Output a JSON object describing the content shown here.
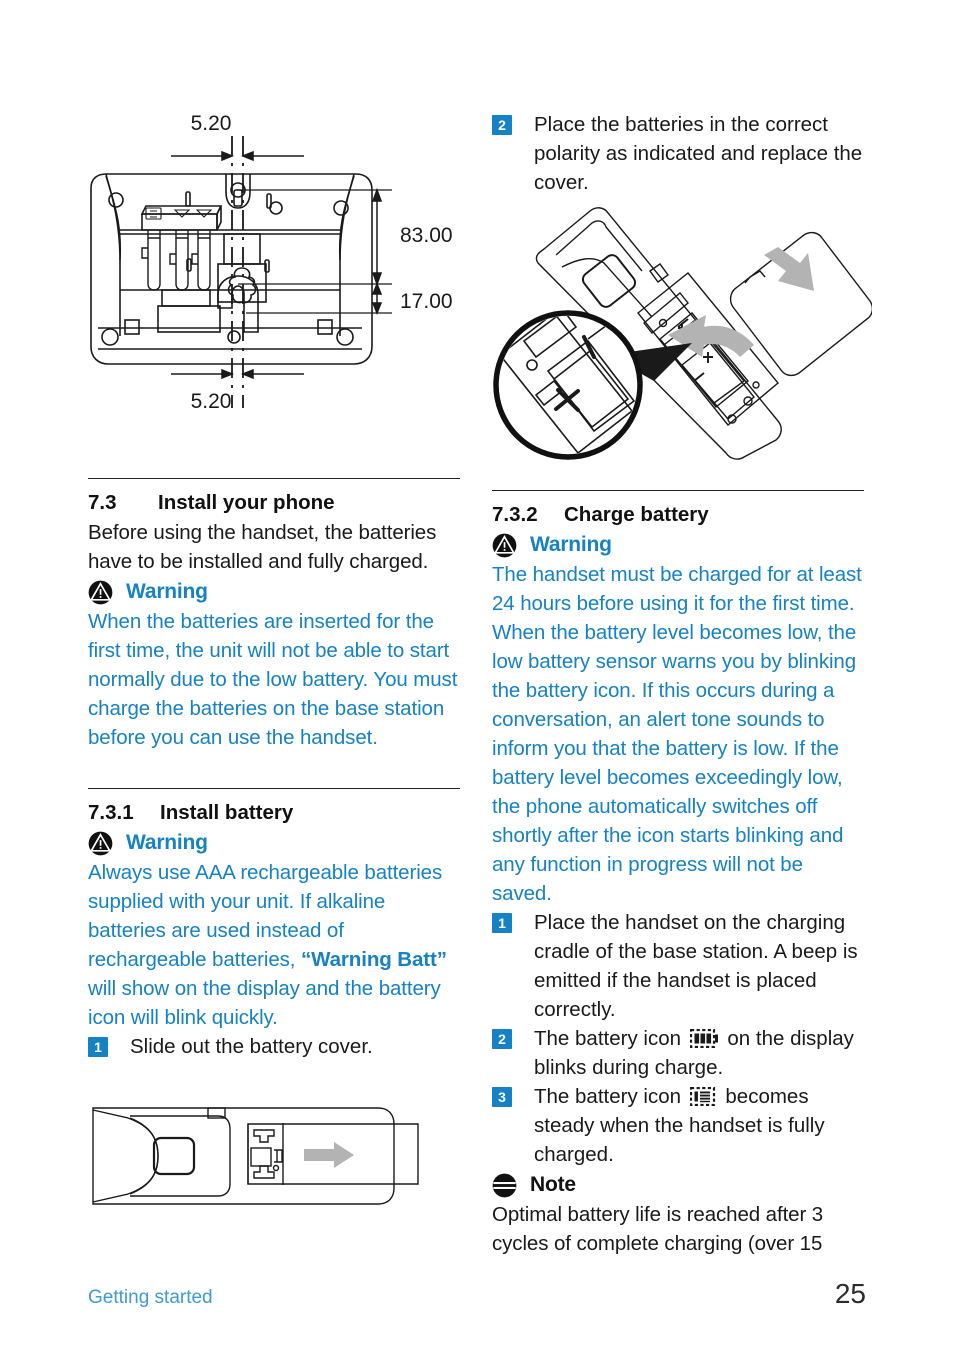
{
  "page": {
    "number": "25",
    "footer_section": "Getting started",
    "accent_blue": "#1582c5",
    "footer_blue": "#3e9bd6",
    "text_black": "#1a1a1a"
  },
  "figures": {
    "base_station_dimensions": {
      "name": "base-station-wall-mount-dimensions",
      "labels": {
        "top": "5.20",
        "bottom": "5.20",
        "right_upper": "83.00",
        "right_lower": "17.00"
      }
    },
    "handset_battery": {
      "name": "handset-battery-polarity-diagram",
      "callout_marks": [
        "+",
        "–",
        "+",
        "–"
      ]
    },
    "cover_slide": {
      "name": "handset-battery-cover-slide-diagram"
    }
  },
  "left_column": {
    "section": {
      "number": "7.3",
      "title": "Install your phone",
      "intro": "Before using the handset, the batteries have to be installed and fully charged.",
      "warning": {
        "icon": "warning-triangle-icon",
        "label": "Warning",
        "text": "When the batteries are inserted for the first time, the unit will not be able to start normally due to the low battery. You must charge the batteries on the base station before you can use the handset."
      }
    },
    "subsection": {
      "number": "7.3.1",
      "title": "Install battery",
      "warning": {
        "icon": "warning-triangle-icon",
        "label": "Warning",
        "text_part1": "Always use AAA rechargeable batteries supplied with your unit. If alkaline batteries are used instead of rechargeable batteries, ",
        "text_bold": "“Warning Batt”",
        "text_part2": " will show on the display and the battery icon will blink quickly."
      },
      "steps": [
        {
          "marker": "1",
          "text": "Slide out the battery cover."
        }
      ]
    }
  },
  "right_column": {
    "top_step": {
      "marker": "2",
      "text": "Place the batteries in the correct polarity as indicated and replace the cover."
    },
    "subsection": {
      "number": "7.3.2",
      "title": "Charge battery",
      "warning": {
        "icon": "warning-triangle-icon",
        "label": "Warning",
        "text": "The handset must be charged for at least 24 hours before using it for the first time. When the battery level becomes low, the low battery sensor warns you by blinking the battery icon. If this occurs during a conversation, an alert tone sounds to inform you that the battery is low. If the battery level becomes exceedingly low, the phone automatically switches off shortly after the icon starts blinking and any function in progress will not be saved."
      },
      "steps": [
        {
          "marker": "1",
          "text": "Place the handset on the charging cradle of the base station. A beep is emitted if the handset is placed correctly."
        },
        {
          "marker": "2",
          "text_before": "The battery icon ",
          "icon": "battery-blinking-icon",
          "text_after": " on the display blinks during charge."
        },
        {
          "marker": "3",
          "text_before": "The battery icon ",
          "icon": "battery-full-icon",
          "text_after": " becomes steady when the handset is fully charged."
        }
      ],
      "note": {
        "icon": "note-icon",
        "label": "Note",
        "text": "Optimal battery life is reached after 3 cycles of complete charging (over 15"
      }
    }
  }
}
